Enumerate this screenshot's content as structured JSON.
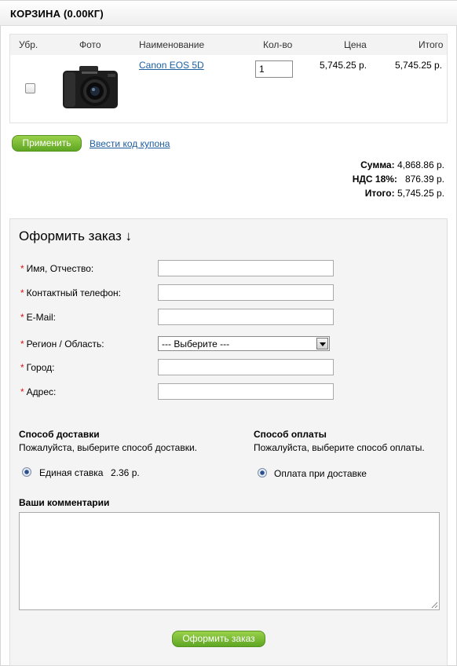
{
  "header": {
    "title": "КОРЗИНА  (0.00КГ)"
  },
  "cart_table": {
    "columns": {
      "remove": "Убр.",
      "photo": "Фото",
      "name": "Наименование",
      "qty": "Кол-во",
      "price": "Цена",
      "total": "Итого"
    },
    "rows": [
      {
        "name": "Canon EOS 5D",
        "qty": "1",
        "price": "5,745.25 р.",
        "total": "5,745.25 р.",
        "image": "camera-photo"
      }
    ]
  },
  "actions": {
    "apply": "Применить",
    "coupon": "Ввести код купона"
  },
  "totals": [
    {
      "label": "Сумма:",
      "value": "4,868.86 р."
    },
    {
      "label": "НДС 18%:",
      "value": "876.39 р."
    },
    {
      "label": "Итого:",
      "value": "5,745.25 р."
    }
  ],
  "checkout": {
    "title": "Оформить заказ ↓",
    "fields": [
      {
        "label": "Имя, Отчество:",
        "value": ""
      },
      {
        "label": "Контактный телефон:",
        "value": ""
      },
      {
        "label": "E-Mail:",
        "value": ""
      },
      {
        "label": "Регион / Область:",
        "selected": "--- Выберите ---"
      },
      {
        "label": "Город:",
        "value": ""
      },
      {
        "label": "Адрес:",
        "value": ""
      }
    ],
    "required_mark": "*",
    "delivery": {
      "title": "Способ доставки",
      "hint": "Пожалуйста, выберите способ доставки.",
      "option": "Единая ставка",
      "option_price": "2.36 р."
    },
    "payment": {
      "title": "Способ оплаты",
      "hint": "Пожалуйста, выберите способ оплаты.",
      "option": "Оплата при доставке"
    },
    "comments_label": "Ваши комментарии",
    "comments_value": "",
    "submit": "Оформить заказ"
  },
  "colors": {
    "link": "#1c5ea0",
    "button": "#6db22e",
    "required": "#dd1111"
  }
}
